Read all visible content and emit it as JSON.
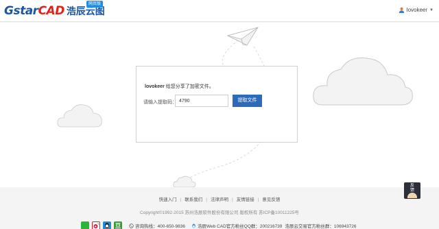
{
  "header": {
    "logo_gstar": "Gstar",
    "logo_cad": "CAD",
    "logo_cn": "浩辰云图",
    "logo_badge": "网页版",
    "username": "lovokeer"
  },
  "card": {
    "share_user": "lovokeer",
    "share_text": " 给您分享了加密文件。",
    "code_label": "请输入提取码：",
    "code_value": "4790",
    "fetch_button": "提取文件"
  },
  "footer": {
    "links": [
      "快速入门",
      "联系我们",
      "法律声明",
      "友情链接",
      "意见反馈"
    ],
    "copyright": "Copyright©1992-2015 苏州浩辰软件股份有限公司 版权所有 苏ICP备10011225号",
    "hotline": "咨询热线：400-650-9836",
    "qq_group": "浩辰Web CAD官方粉丝QQ群：200216739",
    "qq_group2": "浩辰云交易官方粉丝群：106943726"
  },
  "feedback": {
    "label": "反馈"
  },
  "colors": {
    "brand_blue": "#1b55a4",
    "brand_red": "#e2231a",
    "button_blue": "#2d6ab9"
  }
}
